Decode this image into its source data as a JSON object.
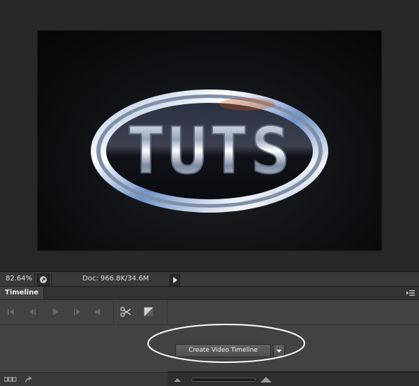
{
  "canvas": {
    "artwork_text": "TUTS",
    "colors": {
      "chrome_light": "#e8eef7",
      "chrome_blue": "#7eaae8",
      "badge_dark": "#15171c"
    }
  },
  "status_bar": {
    "zoom": "82.64%",
    "doc_info": "Doc: 966.8K/34.6M",
    "menu_arrow_icon": "triangle-right-icon"
  },
  "timeline_panel": {
    "tab_label": "Timeline",
    "panel_menu_icon": "panel-menu-icon",
    "controls": [
      "go-to-first-frame-icon",
      "previous-frame-icon",
      "play-icon",
      "next-frame-icon",
      "audio-icon",
      "split-at-playhead-icon",
      "transition-icon"
    ],
    "create_button_label": "Create Video Timeline",
    "create_dropdown_icon": "chevron-down-icon",
    "annotation_color": "#ffffff"
  },
  "footer": {
    "frame_mode_icon": "frame-mode-icon",
    "render_icon": "render-arrow-icon",
    "zoom_out_icon": "small-mountain-icon",
    "zoom_in_icon": "large-mountain-icon"
  }
}
